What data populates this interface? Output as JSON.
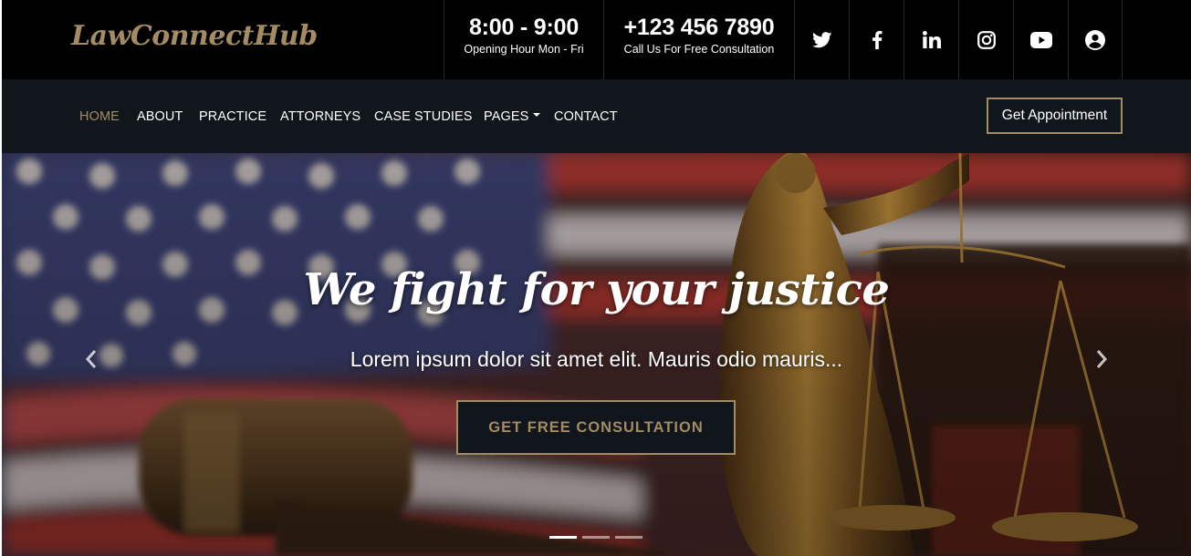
{
  "brand": {
    "name": "LawConnectHub",
    "accent": "#a38b63"
  },
  "topbar": {
    "hours": {
      "value": "8:00 - 9:00",
      "label": "Opening Hour Mon - Fri"
    },
    "phone": {
      "value": "+123 456 7890",
      "label": "Call Us For Free Consultation"
    },
    "social": [
      "twitter-icon",
      "facebook-icon",
      "linkedin-icon",
      "instagram-icon",
      "youtube-icon",
      "user-icon"
    ]
  },
  "nav": {
    "items": [
      {
        "label": "HOME",
        "active": true
      },
      {
        "label": "ABOUT"
      },
      {
        "label": "PRACTICE"
      },
      {
        "label": "ATTORNEYS"
      },
      {
        "label": "CASE STUDIES"
      },
      {
        "label": "PAGES",
        "dropdown": true
      },
      {
        "label": "CONTACT"
      }
    ],
    "cta": "Get Appointment"
  },
  "hero": {
    "title": "We fight for your justice",
    "subtitle": "Lorem ipsum dolor sit amet elit. Mauris odio mauris...",
    "cta": "GET FREE CONSULTATION",
    "slides": 3,
    "active_slide": 1
  }
}
